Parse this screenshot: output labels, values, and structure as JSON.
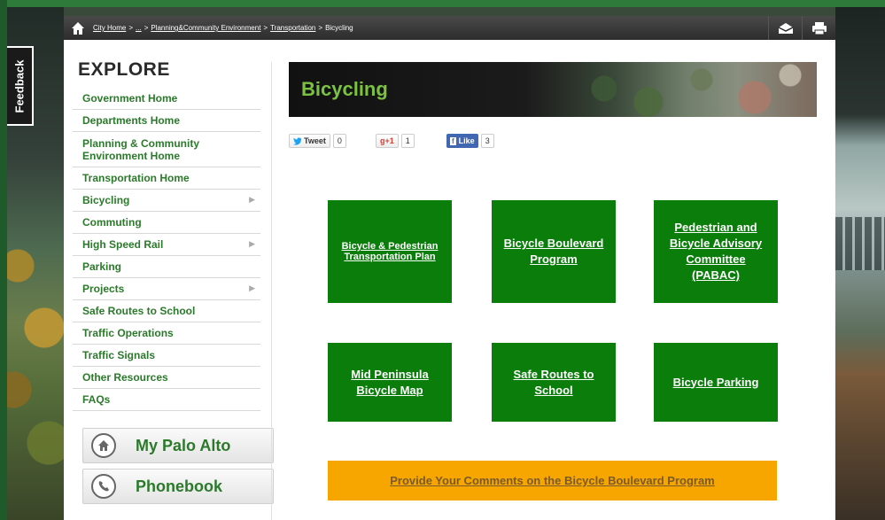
{
  "breadcrumb": {
    "items": [
      "City Home",
      "...",
      "Planning&Community Environment",
      "Transportation"
    ],
    "current": "Bicycling",
    "separator": ">"
  },
  "toolbar": {
    "email_icon": "email-icon",
    "print_icon": "print-icon"
  },
  "feedback": {
    "label": "Feedback"
  },
  "sidebar": {
    "title": "EXPLORE",
    "items": [
      {
        "label": "Government Home",
        "has_arrow": false
      },
      {
        "label": "Departments Home",
        "has_arrow": false
      },
      {
        "label": "Planning & Community Environment Home",
        "has_arrow": false
      },
      {
        "label": "Transportation Home",
        "has_arrow": false
      },
      {
        "label": "Bicycling",
        "has_arrow": true
      },
      {
        "label": "Commuting",
        "has_arrow": false
      },
      {
        "label": "High Speed Rail",
        "has_arrow": true
      },
      {
        "label": "Parking",
        "has_arrow": false
      },
      {
        "label": "Projects",
        "has_arrow": true
      },
      {
        "label": "Safe Routes to School",
        "has_arrow": false
      },
      {
        "label": "Traffic Operations",
        "has_arrow": false
      },
      {
        "label": "Traffic Signals",
        "has_arrow": false
      },
      {
        "label": "Other Resources",
        "has_arrow": false
      },
      {
        "label": "FAQs",
        "has_arrow": false
      }
    ],
    "quick_links": [
      {
        "label": "My Palo Alto",
        "icon": "home-icon"
      },
      {
        "label": "Phonebook",
        "icon": "phone-icon"
      }
    ]
  },
  "main": {
    "title": "Bicycling",
    "social": {
      "tweet_label": "Tweet",
      "tweet_count": "0",
      "gplus_label": "+1",
      "gplus_count": "1",
      "like_label": "Like",
      "like_count": "3"
    },
    "tiles": [
      "Bicycle & Pedestrian Transportation Plan",
      "Bicycle Boulevard Program",
      "Pedestrian and Bicycle Advisory Committee (PABAC)",
      "Mid Peninsula Bicycle Map",
      "Safe Routes to School",
      "Bicycle Parking"
    ],
    "comment_link": "Provide Your Comments on the Bicycle Boulevard Program"
  },
  "colors": {
    "nav_green": "#2b7a2b",
    "tile_green": "#0a7d0a",
    "title_green": "#7bc142",
    "comment_orange": "#f7a600"
  }
}
